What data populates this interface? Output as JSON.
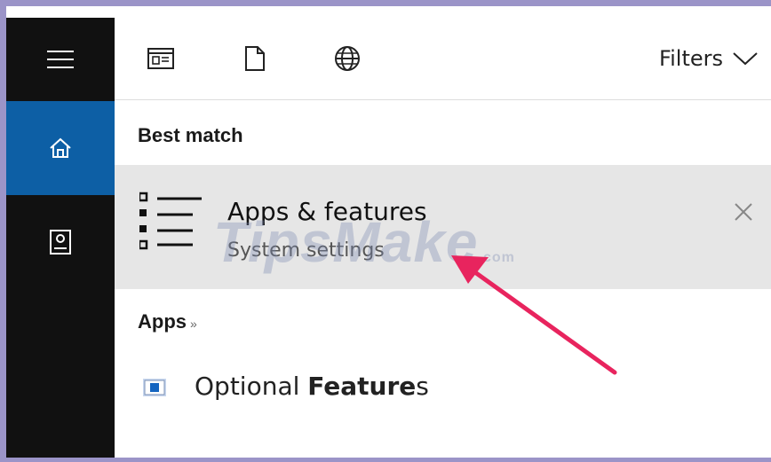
{
  "toolbar": {
    "icons": [
      "apps-icon",
      "documents-icon",
      "web-icon"
    ],
    "filters_label": "Filters"
  },
  "rail": {
    "items": [
      "menu-icon",
      "home-icon",
      "notebook-icon"
    ]
  },
  "best_match": {
    "section_label": "Best match",
    "title": "Apps & features",
    "subtitle": "System settings"
  },
  "apps": {
    "section_label": "Apps",
    "separator": "»",
    "items": [
      {
        "label_prefix": "Optional ",
        "label_bold": "Feature",
        "label_suffix": "s"
      }
    ]
  },
  "watermark": {
    "text": "TipsMake",
    "suffix": ".com"
  },
  "colors": {
    "rail": "#111111",
    "rail_active": "#0d5fa5",
    "highlight_row": "#e6e6e6",
    "arrow": "#e8245e",
    "border": "#9b94c8"
  }
}
